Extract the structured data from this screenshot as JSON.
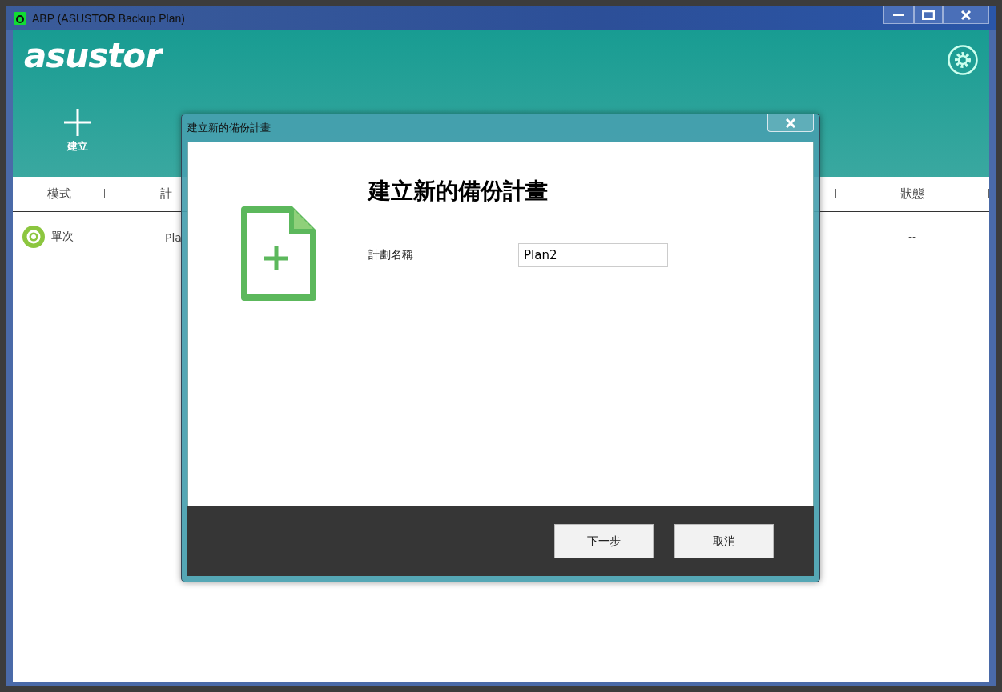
{
  "window": {
    "title": "ABP (ASUSTOR Backup Plan)"
  },
  "app": {
    "logo": "asustor",
    "toolbar": [
      {
        "label": "建立"
      }
    ]
  },
  "table": {
    "columns": [
      "模式",
      "計",
      "狀態"
    ],
    "rows": [
      {
        "mode": "單次",
        "plan": "Pla",
        "status": "--"
      }
    ]
  },
  "dialog": {
    "title": "建立新的備份計畫",
    "heading": "建立新的備份計畫",
    "fields": [
      {
        "label": "計劃名稱",
        "value": "Plan2"
      }
    ],
    "buttons": [
      "下一步",
      "取消"
    ]
  }
}
